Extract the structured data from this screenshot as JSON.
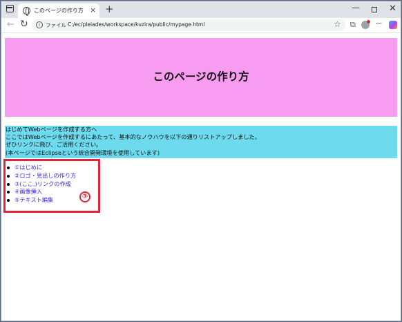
{
  "browser": {
    "tab_title": "このページの作り方",
    "tab_close": "×",
    "new_tab": "+",
    "window_controls": {
      "minimize": "—",
      "close": "✕"
    },
    "address": {
      "file_label": "ファイル",
      "url": "C:/ec/pleiades/workspace/kuzira/public/mypage.html"
    },
    "icons": [
      "tab-actions-icon",
      "globe-icon",
      "back-icon",
      "reload-icon",
      "info-icon",
      "star-icon",
      "collections-icon",
      "profile-avatar",
      "more-icon",
      "copilot-icon"
    ]
  },
  "page": {
    "title": "このページの作り方",
    "intro_lines": [
      "はじめてWebページを作成する方へ",
      "ここではWebページを作成するにあたって、基本的なノウハウを以下の通りリストアップしました。",
      "ぜひリンクに飛び、ご活用ください。",
      "(本ページではEclipseという統合開発環境を使用しています)"
    ],
    "toc_links": [
      "①はじめに",
      "②ロゴ・見出しの作り方",
      "③(ここ,)リンクの作成",
      "④画像挿入",
      "⑤テキスト編集"
    ]
  },
  "annotation": {
    "badge": "③",
    "color": "#e0243a"
  },
  "colors": {
    "header_bg": "#f79cf0",
    "intro_bg": "#6ddaee",
    "link": "#3b1fe0"
  }
}
